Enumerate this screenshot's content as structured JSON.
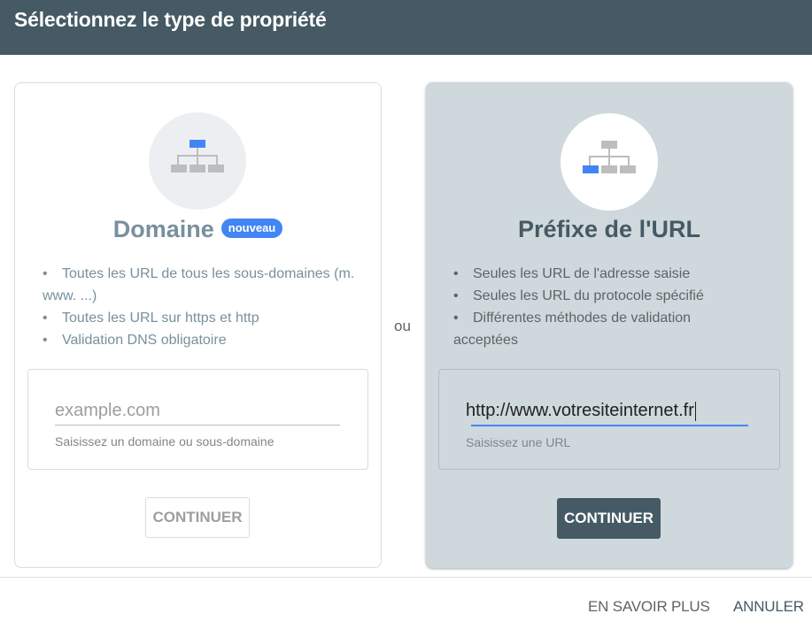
{
  "dialog": {
    "title": "Sélectionnez le type de propriété"
  },
  "domain_card": {
    "title": "Domaine",
    "badge": "nouveau",
    "features": [
      "Toutes les URL de tous les sous-domaines (m. www. ...)",
      "Toutes les URL sur https et http",
      "Validation DNS obligatoire"
    ],
    "input": {
      "placeholder": "example.com",
      "value": "",
      "hint": "Saisissez un domaine ou sous-domaine"
    },
    "button_label": "CONTINUER",
    "icon": "sitemap-top-highlight-icon"
  },
  "separator": "ou",
  "url_card": {
    "title": "Préfixe de l'URL",
    "features": [
      "Seules les URL de l'adresse saisie",
      "Seules les URL du protocole spécifié",
      "Différentes méthodes de validation acceptées"
    ],
    "input": {
      "value": "http://www.votresiteinternet.fr",
      "hint": "Saisissez une URL"
    },
    "button_label": "CONTINUER",
    "icon": "sitemap-leaf-highlight-icon"
  },
  "footer": {
    "learn_more": "EN SAVOIR PLUS",
    "cancel": "ANNULER"
  },
  "colors": {
    "header": "#455a64",
    "accent": "#4285f4",
    "selected_card": "#cfd8dc"
  }
}
